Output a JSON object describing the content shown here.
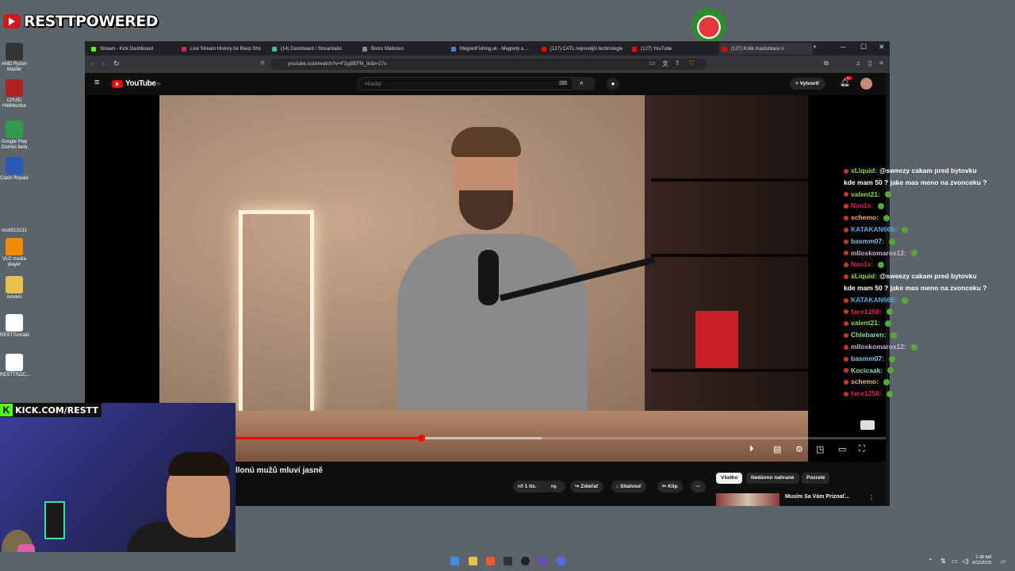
{
  "desktop": {
    "brand": "RESTTPOWERED",
    "icons": [
      {
        "label": "AMD Ryzen Master",
        "color": "#333333"
      },
      {
        "label": "CPUID HWMonitor",
        "color": "#b22222"
      },
      {
        "label": "Google Play Games beta",
        "color": "#2e9c4a"
      },
      {
        "label": "Clash Royale",
        "color": "#2c58b8"
      },
      {
        "label": "restt313131",
        "color": "#5b646a"
      },
      {
        "label": "VLC media player",
        "color": "#f28c00"
      },
      {
        "label": "movies",
        "color": "#e8c14a"
      },
      {
        "label": "RESTTsocials",
        "color": "#ffffff"
      },
      {
        "label": "RESTTSOC...",
        "color": "#ffffff"
      }
    ]
  },
  "browser": {
    "tabs": [
      {
        "label": "Stream - Kick Dashboard",
        "color": "#53fc18"
      },
      {
        "label": "Live Stream History for Blerp Sho",
        "color": "#e0245e"
      },
      {
        "label": "(14) Dashboard / Streamlabs",
        "color": "#31c3a2"
      },
      {
        "label": "Bistro Malinovo",
        "color": "#888888"
      },
      {
        "label": "MagnetFishing.sk - Magnety a ...",
        "color": "#4a7fd4"
      },
      {
        "label": "(127) CATL nejnovější technologie",
        "color": "#ff0000"
      },
      {
        "label": "(127) YouTube",
        "color": "#ff0000"
      },
      {
        "label": "(127) Kolik masturbace ú",
        "color": "#ff0000"
      }
    ],
    "url": "youtube.com/watch?v=F2yj8EFN_Ik&t=27s",
    "window_controls": {
      "minimize": "─",
      "maximize": "☐",
      "close": "✕"
    }
  },
  "youtube": {
    "logo_text": "YouTube",
    "logo_region": "SK",
    "search_placeholder": "Hľadať",
    "create_label": "Vytvoriť",
    "notif_count": "9+",
    "video_title": "llonú mužů mluví jasně",
    "progress_fraction": 0.42,
    "buffered_fraction": 0.57,
    "actions": {
      "like": "1 tis.",
      "share": "Zdieľať",
      "download": "Stiahnuť",
      "clip": "Klip"
    },
    "chips": [
      "Všetko",
      "Nedávno nahrané",
      "Pozreté"
    ],
    "rec": {
      "title": "Musím Sa Vám Priznať..."
    }
  },
  "chat": [
    {
      "user": "xLiquid:",
      "color": "#8be04e",
      "msg": "@sweezy cakam pred bytovku"
    },
    {
      "user": "",
      "color": "#ffffff",
      "msg": "kde mam 50 ? jake mas meno na zvonceku ?"
    },
    {
      "user": "valent21:",
      "color": "#8be04e",
      "msg": ""
    },
    {
      "user": "Nan1s:",
      "color": "#e0245e",
      "msg": ""
    },
    {
      "user": "schemo:",
      "color": "#f0b27a",
      "msg": ""
    },
    {
      "user": "KATAKAN666:",
      "color": "#5dade2",
      "msg": ""
    },
    {
      "user": "basmm07:",
      "color": "#85c1e9",
      "msg": ""
    },
    {
      "user": "mlloskomaros12:",
      "color": "#d2b4de",
      "msg": ""
    },
    {
      "user": "Nan1s:",
      "color": "#e0245e",
      "msg": ""
    },
    {
      "user": "xLiquid:",
      "color": "#8be04e",
      "msg": "@sweezy cakam pred bytovku"
    },
    {
      "user": "",
      "color": "#ffffff",
      "msg": "kde mam 50 ? jake mas meno na zvonceku ?"
    },
    {
      "user": "KATAKAN666:",
      "color": "#5dade2",
      "msg": ""
    },
    {
      "user": "face1258:",
      "color": "#e0245e",
      "msg": ""
    },
    {
      "user": "valent21:",
      "color": "#8be04e",
      "msg": ""
    },
    {
      "user": "Chlebaren:",
      "color": "#82e0aa",
      "msg": ""
    },
    {
      "user": "mlloskomaros12:",
      "color": "#d2b4de",
      "msg": ""
    },
    {
      "user": "basmm07:",
      "color": "#85c1e9",
      "msg": ""
    },
    {
      "user": "Kocicaak:",
      "color": "#82e0aa",
      "msg": ""
    },
    {
      "user": "schemo:",
      "color": "#f0b27a",
      "msg": ""
    },
    {
      "user": "face1258:",
      "color": "#e0245e",
      "msg": ""
    }
  ],
  "overlay": {
    "kick_text": "KICK.COM/RESTT",
    "kick_letter": "K"
  },
  "taskbar": {
    "time": "1:38 AM",
    "date": "9/12/2025"
  }
}
